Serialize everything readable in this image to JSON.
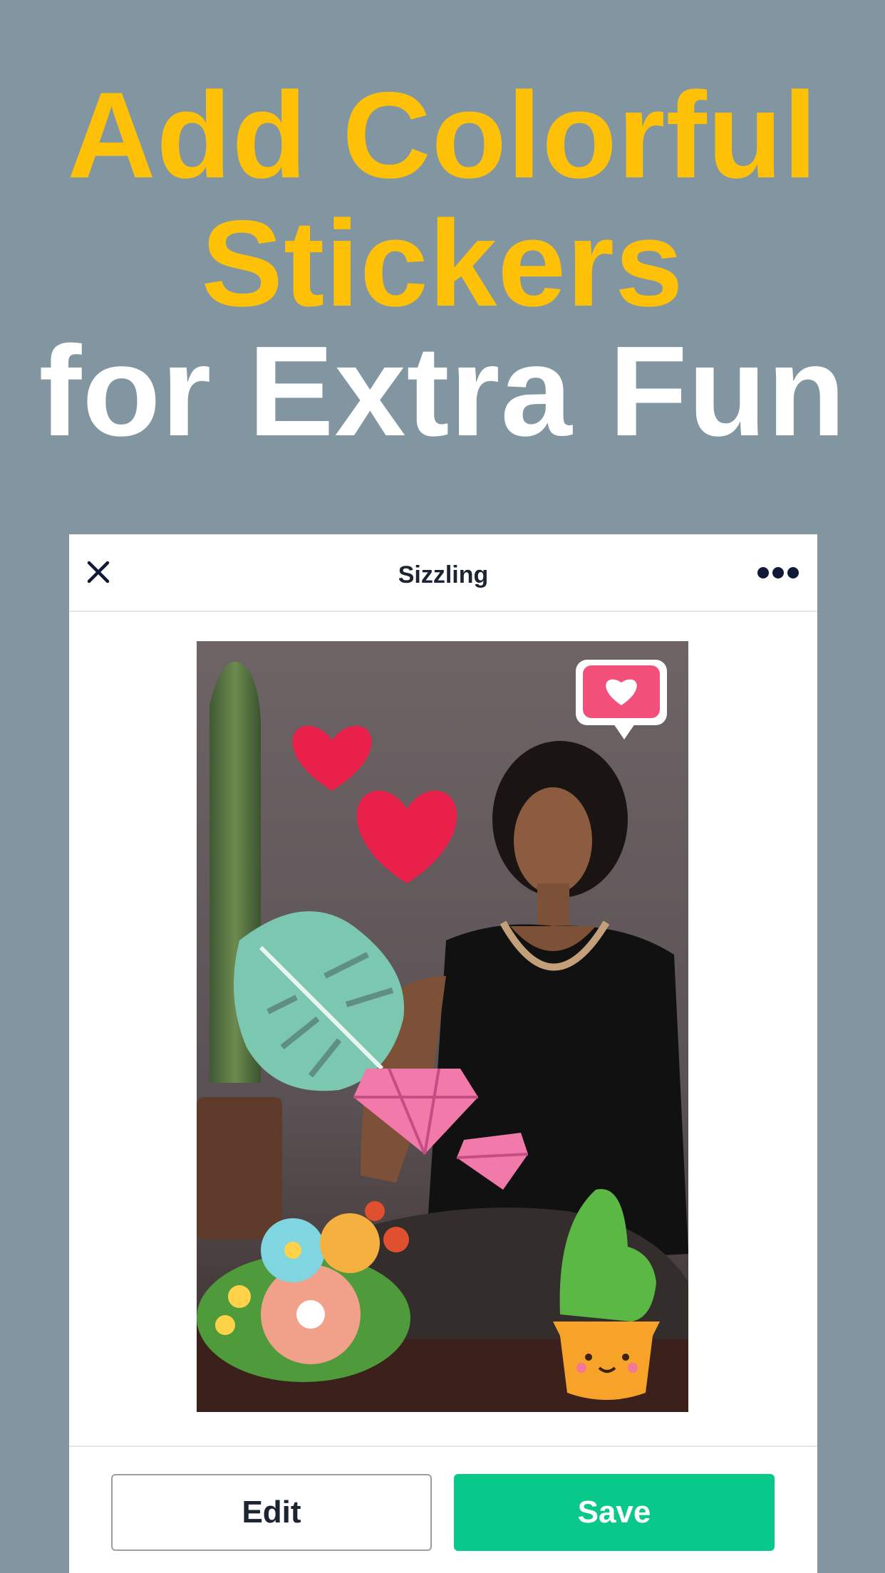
{
  "headline": {
    "line1": "Add Colorful",
    "line2": "Stickers",
    "line3": "for Extra Fun"
  },
  "header": {
    "title": "Sizzling",
    "close_icon": "close-icon",
    "more_icon": "more-options-icon"
  },
  "photo": {
    "stickers": [
      "like-bubble-sticker",
      "heart-sticker",
      "heart-sticker",
      "monstera-leaf-sticker",
      "diamond-sticker",
      "diamond-sticker",
      "flower-bouquet-sticker",
      "cactus-pot-sticker"
    ]
  },
  "footer": {
    "edit_label": "Edit",
    "save_label": "Save"
  },
  "colors": {
    "background": "#8196a1",
    "headline_accent": "#ffc107",
    "save_button": "#09c98a",
    "heart": "#e8204a"
  }
}
